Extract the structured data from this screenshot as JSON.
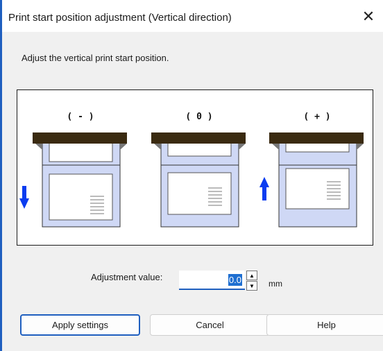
{
  "window": {
    "title": "Print start position adjustment (Vertical direction)",
    "close_glyph": "✕"
  },
  "instruction": "Adjust the vertical print start position.",
  "diagram": {
    "labels": [
      "( - )",
      "( 0 )",
      "( + )"
    ],
    "colors": {
      "bar": "#3a2a10",
      "paper_fill": "#cfd8f5",
      "arrow": "#0a3cf0"
    },
    "icons": [
      "arrow-down-icon",
      "arrow-up-icon"
    ]
  },
  "adjustment": {
    "label": "Adjustment value:",
    "value": "0.0",
    "unit": "mm"
  },
  "buttons": {
    "apply": "Apply settings",
    "cancel": "Cancel",
    "help": "Help"
  }
}
